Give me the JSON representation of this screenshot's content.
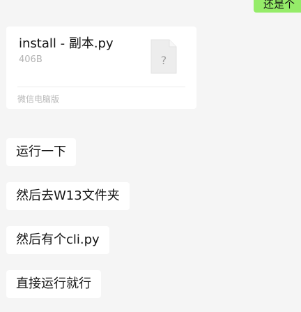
{
  "outgoing": {
    "partial_text": "还是个"
  },
  "file_message": {
    "file_name": "install - 副本.py",
    "file_size": "406B",
    "icon": "unknown-file-icon",
    "icon_glyph": "?",
    "source": "微信电脑版"
  },
  "messages": [
    {
      "text": "运行一下"
    },
    {
      "text": "然后去W13文件夹"
    },
    {
      "text": "然后有个cli.py"
    },
    {
      "text": "直接运行就行"
    }
  ],
  "colors": {
    "background": "#f5f5f5",
    "incoming_bubble": "#ffffff",
    "outgoing_bubble": "#95ec69"
  }
}
